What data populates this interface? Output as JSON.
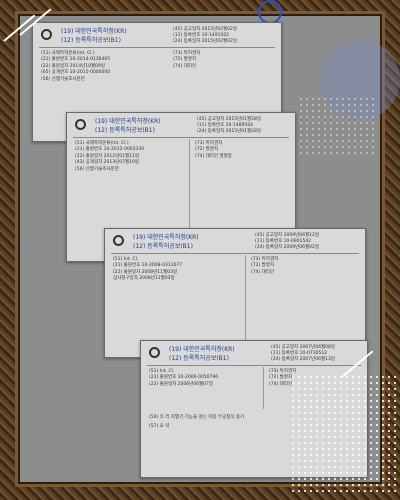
{
  "docs": [
    {
      "title_kr_org": "(19) 대한민국특허청(KR)",
      "title_kr_type": "(12) 등록특허공보(B1)",
      "meta": [
        "(45) 공고일자  2015년02월02일",
        "(11) 등록번호  10-1491502",
        "(24) 등록일자  2015년02월02일"
      ],
      "fields": [
        "(51) 국제특허분류(Int. Cl.)",
        "(21) 출원번호  10-2014-0136405",
        "(22) 출원일자  2014년10월09일",
        "(65) 공개번호  10-2015-0000000",
        "(56) 선행기술조사문헌",
        "(73) 특허권자",
        "(72) 발명자",
        "(74) 대리인"
      ]
    },
    {
      "title_kr_org": "(19) 대한민국특허청(KR)",
      "title_kr_type": "(12) 등록특허공보(B1)",
      "meta": [
        "(45) 공고일자  2015년01월28일",
        "(11) 등록번호  10-1489504",
        "(24) 등록일자  2015년01월28일"
      ],
      "fields": [
        "(51) 국제특허분류(Int. Cl.)",
        "(21) 출원번호  10-2012-0003330",
        "(22) 출원일자  2012년01월11일",
        "(43) 공개일자  2013년07월19일",
        "(56) 선행기술조사문헌",
        "(73) 특허권자",
        "(72) 발명자",
        "(74) 대리인  명명종"
      ]
    },
    {
      "title_kr_org": "(19) 대한민국특허청(KR)",
      "title_kr_type": "(12) 등록특허공보(B1)",
      "meta": [
        "(45) 공고일자  2009년06월12일",
        "(11) 등록번호  10-0901542",
        "(24) 등록일자  2009년06월02일"
      ],
      "fields": [
        "(51) Int. Cl.",
        "(21) 출원번호  10-2008-0311077",
        "(22) 출원일자  2008년11월03일",
        "심사청구일자  2008년11월03일",
        "(73) 특허권자",
        "(72) 발명자",
        "(74) 대리인"
      ]
    },
    {
      "title_kr_org": "(19) 대한민국특허청(KR)",
      "title_kr_type": "(12) 등록특허공보(B1)",
      "meta": [
        "(45) 공고일자  2007년06월08일",
        "(11) 등록번호  10-0730512",
        "(24) 등록일자  2007년06월13일"
      ],
      "fields": [
        "(51) Int. Cl.",
        "(21) 출원번호  10-2006-0050796",
        "(22) 출원일자  2006년06월07일",
        "(73) 특허권자",
        "(72) 발명자",
        "(74) 대리인"
      ],
      "red_lines": [
        "(54) 유 리 지열기 기능을 갖는 이중 무공정식 용기",
        "(57) 요 약"
      ]
    }
  ],
  "colors": {
    "frame": "#4a3520",
    "doc_bg": "#d9d9d9",
    "title_blue": "#1f3a8a",
    "accent_red": "#b22222"
  }
}
